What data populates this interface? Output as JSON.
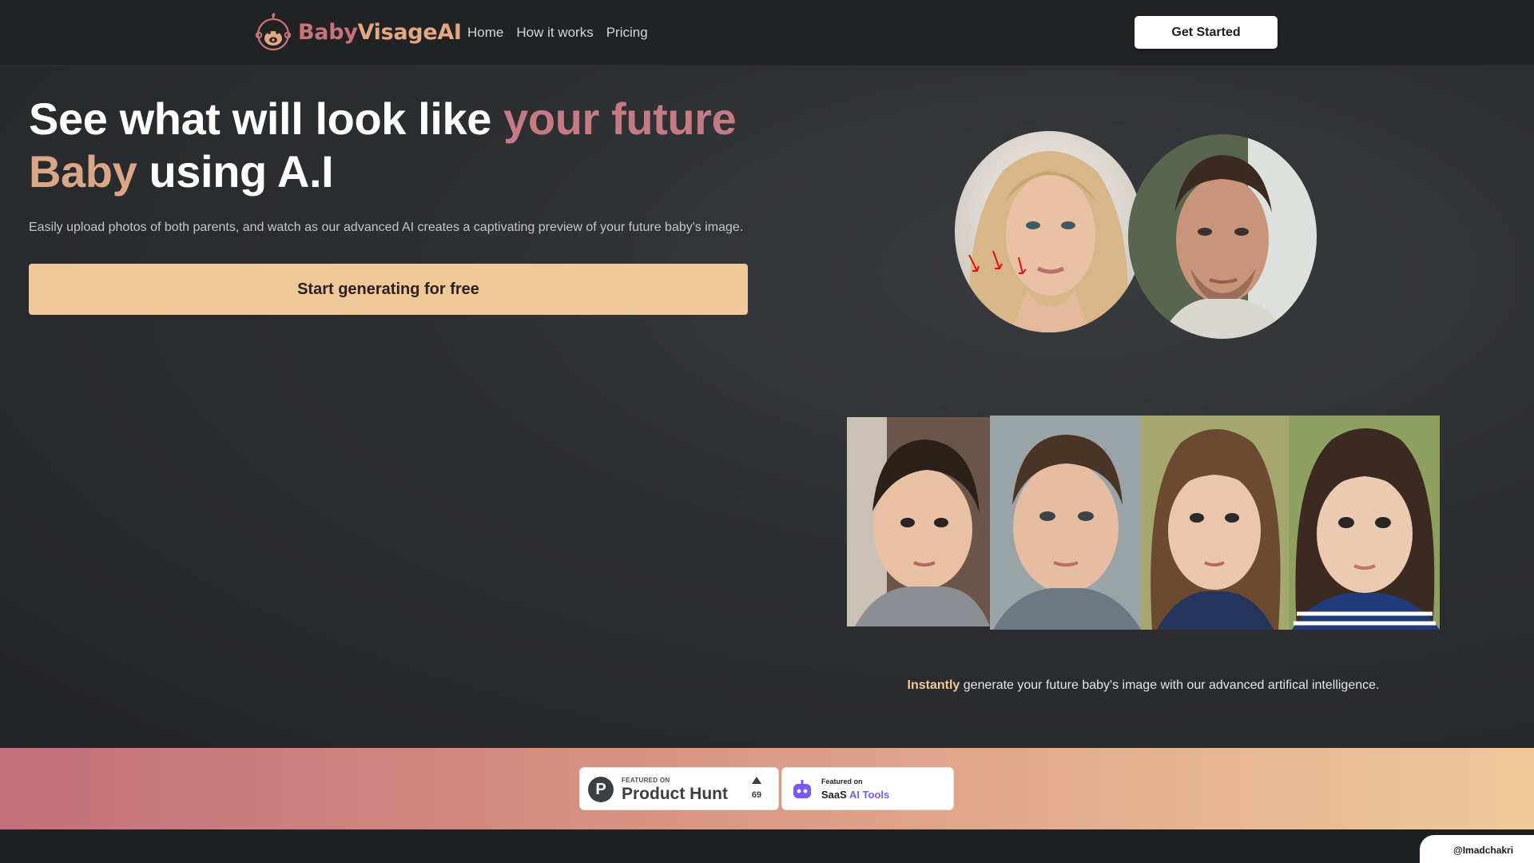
{
  "nav": {
    "logo": {
      "part1": "Baby",
      "part2": "VisageAI"
    },
    "links": [
      "Home",
      "How it works",
      "Pricing"
    ],
    "cta": "Get Started"
  },
  "hero": {
    "title_a": "See what will look like ",
    "title_b": "your future",
    "title_c": "Baby",
    "title_d": " using A.I",
    "subtitle": "Easily upload photos of both parents, and watch as our advanced AI creates a captivating preview of your future baby's image.",
    "cta": "Start generating for free",
    "caption_accent": "Instantly",
    "caption_rest": " generate your future baby's image with our advanced artifical intelligence."
  },
  "badges": {
    "producthunt": {
      "small": "FEATURED ON",
      "big": "Product Hunt",
      "count": "69"
    },
    "saas": {
      "small": "Featured on",
      "big_a": "SaaS ",
      "big_b": "AI Tools"
    }
  },
  "credit": "@Imadchakri",
  "colors": {
    "accent_pink": "#c57b84",
    "accent_peach": "#f0c99a",
    "background": "#2a2b2e"
  }
}
